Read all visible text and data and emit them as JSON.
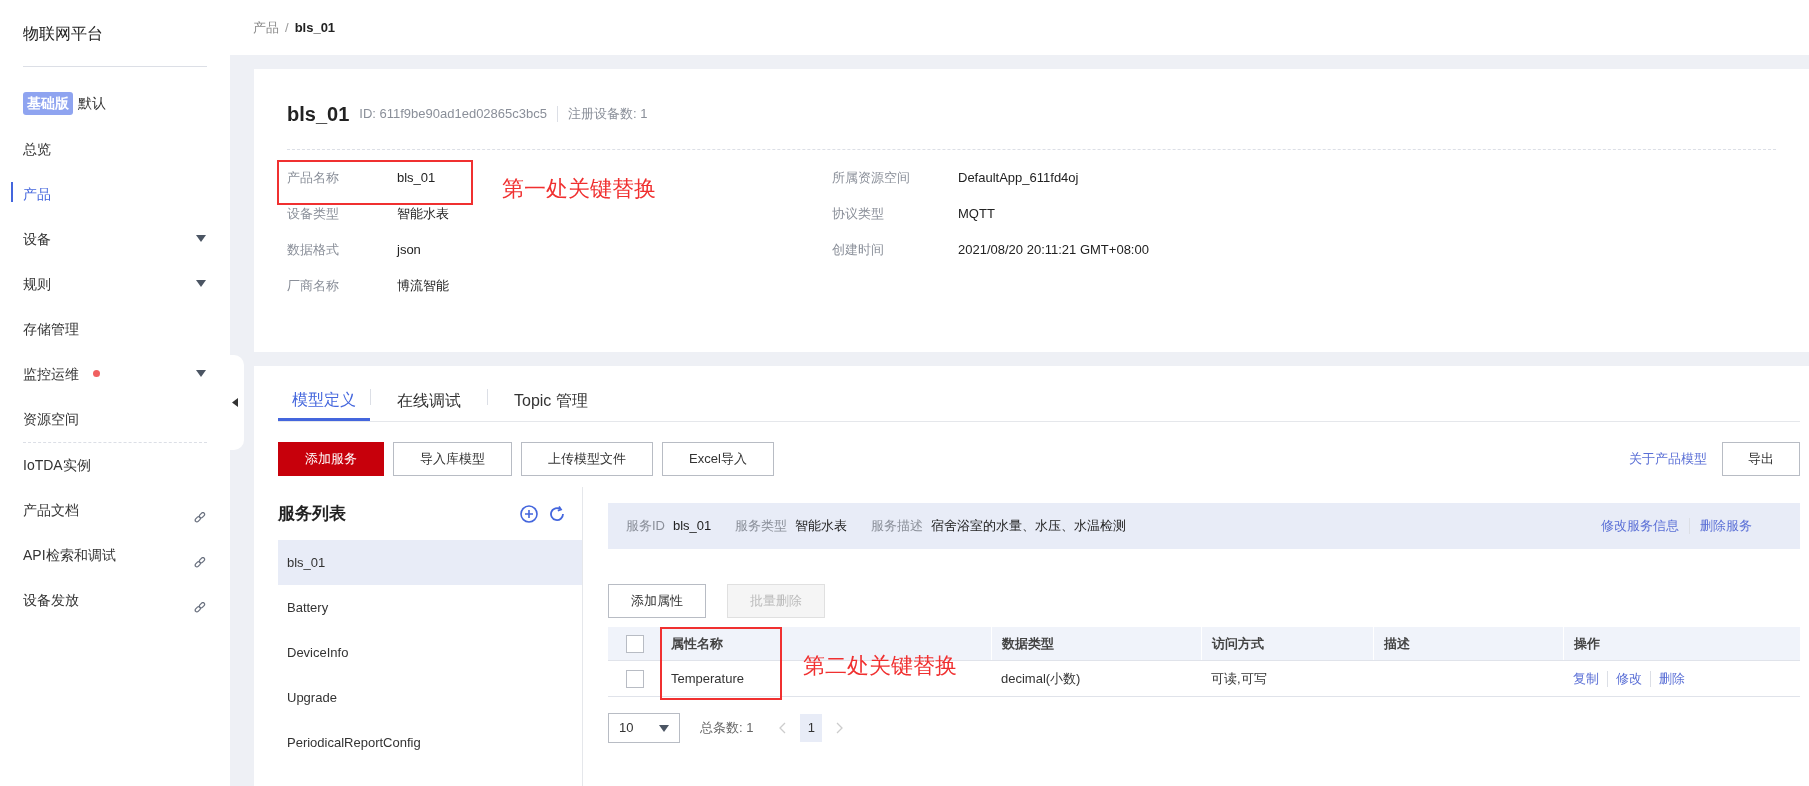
{
  "sidebar": {
    "title": "物联网平台",
    "edition": {
      "badge": "基础版",
      "label": "默认"
    },
    "items": [
      {
        "label": "总览",
        "kind": "plain",
        "selected": false,
        "alert": false
      },
      {
        "label": "产品",
        "kind": "plain",
        "selected": true,
        "alert": false
      },
      {
        "label": "设备",
        "kind": "dropdown",
        "selected": false,
        "alert": false
      },
      {
        "label": "规则",
        "kind": "dropdown",
        "selected": false,
        "alert": false
      },
      {
        "label": "存储管理",
        "kind": "plain",
        "selected": false,
        "alert": false
      },
      {
        "label": "监控运维",
        "kind": "dropdown",
        "selected": false,
        "alert": true
      },
      {
        "label": "资源空间",
        "kind": "plain",
        "selected": false,
        "alert": false
      }
    ],
    "extra_items": [
      {
        "label": "IoTDA实例",
        "kind": "plain",
        "selected": false,
        "alert": false
      },
      {
        "label": "产品文档",
        "kind": "external",
        "selected": false,
        "alert": false
      },
      {
        "label": "API检索和调试",
        "kind": "external",
        "selected": false,
        "alert": false
      },
      {
        "label": "设备发放",
        "kind": "external",
        "selected": false,
        "alert": false
      }
    ]
  },
  "breadcrumb": {
    "items": [
      "产品",
      "bls_01"
    ],
    "separator": "/"
  },
  "product": {
    "name": "bls_01",
    "id": "ID: 611f9be90ad1ed02865c3bc5",
    "devices": "注册设备数: 1",
    "details_left": [
      {
        "label": "产品名称",
        "value": "bls_01"
      },
      {
        "label": "设备类型",
        "value": "智能水表"
      },
      {
        "label": "数据格式",
        "value": "json"
      },
      {
        "label": "厂商名称",
        "value": "博流智能"
      }
    ],
    "details_right": [
      {
        "label": "所属资源空间",
        "value": "DefaultApp_611fd4oj"
      },
      {
        "label": "协议类型",
        "value": "MQTT"
      },
      {
        "label": "创建时间",
        "value": "2021/08/20 20:11:21 GMT+08:00"
      }
    ],
    "annotation": "第一处关键替换"
  },
  "tabs": [
    {
      "label": "模型定义",
      "selected": true
    },
    {
      "label": "在线调试",
      "selected": false
    },
    {
      "label": "Topic 管理",
      "selected": false
    }
  ],
  "toolbar": {
    "buttons": [
      {
        "label": "添加服务",
        "kind": "primary"
      },
      {
        "label": "导入库模型",
        "kind": "default"
      },
      {
        "label": "上传模型文件",
        "kind": "default"
      },
      {
        "label": "Excel导入",
        "kind": "default"
      }
    ],
    "link": "关于产品模型",
    "export": "导出"
  },
  "services": {
    "title": "服务列表",
    "items": [
      {
        "label": "bls_01",
        "selected": true
      },
      {
        "label": "Battery",
        "selected": false
      },
      {
        "label": "DeviceInfo",
        "selected": false
      },
      {
        "label": "Upgrade",
        "selected": false
      },
      {
        "label": "PeriodicalReportConfig",
        "selected": false
      }
    ]
  },
  "service_info": {
    "fields": [
      {
        "label": "服务ID",
        "value": "bls_01"
      },
      {
        "label": "服务类型",
        "value": "智能水表"
      },
      {
        "label": "服务描述",
        "value": "宿舍浴室的水量、水压、水温检测"
      }
    ],
    "actions": [
      "修改服务信息",
      "删除服务"
    ]
  },
  "property_buttons": [
    {
      "label": "添加属性",
      "disabled": false
    },
    {
      "label": "批量删除",
      "disabled": true
    }
  ],
  "table": {
    "select_all": false,
    "columns": [
      "属性名称",
      "数据类型",
      "访问方式",
      "描述",
      "操作"
    ],
    "rows": [
      {
        "checked": false,
        "name": "Temperature",
        "data_type": "decimal(小数)",
        "access": "可读,可写",
        "actions": [
          "复制",
          "修改",
          "删除"
        ]
      }
    ],
    "annotation": "第二处关键替换"
  },
  "pagination": {
    "page_size": "10",
    "total": "总条数: 1",
    "pages": [
      {
        "label": "1",
        "selected": true
      }
    ]
  }
}
